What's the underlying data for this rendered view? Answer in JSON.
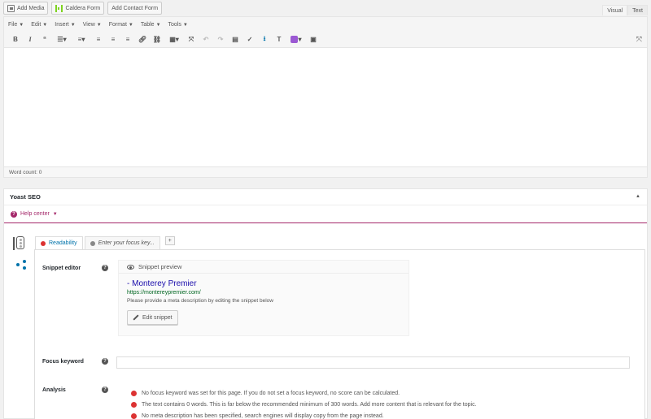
{
  "media_buttons": {
    "add_media": "Add Media",
    "caldera_form": "Caldera Form",
    "add_contact_form": "Add Contact Form"
  },
  "mode_tabs": {
    "visual": "Visual",
    "text": "Text"
  },
  "menubar": {
    "items": [
      "File",
      "Edit",
      "Insert",
      "View",
      "Format",
      "Table",
      "Tools"
    ]
  },
  "toolbar": {
    "buttons": [
      "bold-icon",
      "italic-icon",
      "blockquote-icon",
      "bullet-list-icon",
      "numbered-list-icon",
      "align-left-icon",
      "align-center-icon",
      "align-right-icon",
      "link-icon",
      "unlink-icon",
      "table-icon",
      "fullscreen-icon",
      "undo-icon",
      "redo-icon",
      "keyboard-icon",
      "spellcheck-icon",
      "download-icon",
      "paste-text-icon",
      "color-icon",
      "grid-icon"
    ]
  },
  "editor": {
    "word_count": "Word count: 0"
  },
  "yoast": {
    "title": "Yoast SEO",
    "help_center": "Help center",
    "tabs": {
      "readability": "Readability",
      "keyword_placeholder": "Enter your focus key..."
    },
    "snippet_editor_label": "Snippet editor",
    "snippet_preview_title": "Snippet preview",
    "snippet": {
      "title": "- Monterey Premier",
      "url": "https://montereypremier.com/",
      "description": "Please provide a meta description by editing the snippet below",
      "edit_button": "Edit snippet"
    },
    "focus_keyword_label": "Focus keyword",
    "analysis_label": "Analysis",
    "analysis_items": [
      "No focus keyword was set for this page. If you do not set a focus keyword, no score can be calculated.",
      "The text contains 0 words. This is far below the recommended minimum of 300 words. Add more content that is relevant for the topic.",
      "No meta description has been specified, search engines will display copy from the page instead."
    ],
    "colors": {
      "accent": "#a4286a",
      "bad": "#dc3232",
      "link": "#0073aa"
    }
  }
}
